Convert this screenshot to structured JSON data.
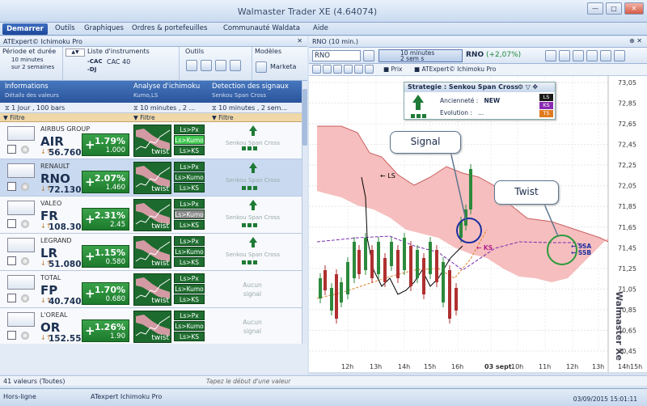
{
  "app": {
    "title": "Walmaster Trader XE  (4.64074)"
  },
  "menu": {
    "start": "Demarrer",
    "items": [
      "Outils",
      "Graphiques",
      "Ordres & portefeuilles",
      "Communauté Waldata",
      "Aide"
    ]
  },
  "left_panel": {
    "title": "ATExpert© Ichimoku Pro",
    "ribbon": {
      "period_label": "Période et durée",
      "period_value_1": "10 minutes",
      "period_value_2": "sur 2 semaines",
      "list_label": "Liste d'instruments",
      "list_a": "-CAC",
      "list_b": "-DJ",
      "list_value": "CAC 40",
      "tools_label": "Outils",
      "models_label": "Modèles",
      "models_value": "Marketa"
    },
    "columns": {
      "info": "Informations",
      "info_sub": "Détails des valeurs",
      "ichimoku": "Analyse d'ichimoku",
      "ichimoku_sub": "Kumo,LS",
      "signals": "Detection des signaux",
      "signals_sub": "Senkou Span Cross"
    },
    "subhead": {
      "info": "1 Jour , 100 bars",
      "ichimoku": "10 minutes , 2 ...",
      "signals": "10 minutes , 2 sem..."
    },
    "filter_label": "Filtre",
    "rows": [
      {
        "name": "AIRBUS GROUP",
        "ticker": "AIR",
        "price": "56.760",
        "pct": "1.79%",
        "abs": "1.000",
        "tags": [
          "Ls>Px",
          "Ls>Kumo",
          "Ls>KS"
        ],
        "signal": "Senkou Span Cross",
        "has_signal": true,
        "twist": "twist"
      },
      {
        "name": "RENAULT",
        "ticker": "RNO",
        "price": "72.130",
        "pct": "2.07%",
        "abs": "1.460",
        "tags": [
          "Ls>Px",
          "Ls>Kumo",
          "Ls>KS"
        ],
        "signal": "Senkou Span Cross",
        "has_signal": true,
        "twist": "twist"
      },
      {
        "name": "VALEO",
        "ticker": "FR",
        "price": "108.30",
        "pct": "2.31%",
        "abs": "2.45",
        "tags": [
          "Ls>Px",
          "Ls>Kumo",
          "Ls>KS"
        ],
        "signal": "Senkou Span Cross",
        "has_signal": true,
        "twist": "twist"
      },
      {
        "name": "LEGRAND",
        "ticker": "LR",
        "price": "51.080",
        "pct": "1.15%",
        "abs": "0.580",
        "tags": [
          "Ls>Px",
          "Ls>Kumo",
          "Ls>KS"
        ],
        "signal": "Senkou Span Cross",
        "has_signal": true,
        "twist": "twist"
      },
      {
        "name": "TOTAL",
        "ticker": "FP",
        "price": "40.740",
        "pct": "1.70%",
        "abs": "0.680",
        "tags": [
          "Ls>Px",
          "Ls>Kumo",
          "Ls>KS"
        ],
        "signal": "Aucun signal",
        "has_signal": false,
        "twist": "twist"
      },
      {
        "name": "L'OREAL",
        "ticker": "OR",
        "price": "152.55",
        "pct": "1.26%",
        "abs": "1.90",
        "tags": [
          "Ls>Px",
          "Ls>Kumo",
          "Ls>KS"
        ],
        "signal": "Aucun signal",
        "has_signal": false,
        "twist": "twist"
      }
    ],
    "count": "41 valeurs (Toutes)",
    "search_placeholder": "Tapez le début d'une valeur"
  },
  "right_panel": {
    "title": "RNO (10 min.)",
    "symbol": "RNO",
    "period_1": "10 minutes",
    "period_2": "2 sem s",
    "quote_ticker": "RNO",
    "quote_change": "(+2,07%)",
    "toolbar2": {
      "prix": "Prix",
      "expert": "ATExpert© Ichimoku Pro"
    },
    "strategy": {
      "title": "Strategie : Senkou Span Cross",
      "anc_label": "Ancienneté :",
      "anc_value": "NEW",
      "evo_label": "Evolution :",
      "evo_value": "...",
      "badges": [
        "LS",
        "KS",
        "TS"
      ]
    },
    "callouts": {
      "signal": "Signal",
      "twist": "Twist"
    },
    "watermark": "Walmaster Xe"
  },
  "status": {
    "left": "Hors-ligne",
    "mid": "ATexpert Ichimoku Pro",
    "right": "03/09/2015 15:01:11"
  },
  "chart_data": {
    "type": "line",
    "y_ticks": [
      "73,05",
      "72,85",
      "72,65",
      "72,45",
      "72,25",
      "72,05",
      "71,85",
      "71,65",
      "71,45",
      "71,25",
      "71,05",
      "70,85",
      "70,65",
      "70,45"
    ],
    "x_ticks": [
      "12h",
      "13h",
      "14h",
      "15h",
      "16h",
      "03 sept.",
      "10h",
      "11h",
      "12h",
      "13h",
      "14h",
      "15h"
    ],
    "labels": {
      "ls": "LS",
      "ks": "KS",
      "ssa": "SSA",
      "ssb": "SSB"
    },
    "colors": {
      "kumo": "#f4b3b3",
      "price": "#2c8a3c",
      "ls": "#000000",
      "ks": "#7b2bb0",
      "ts": "#e08020"
    }
  }
}
